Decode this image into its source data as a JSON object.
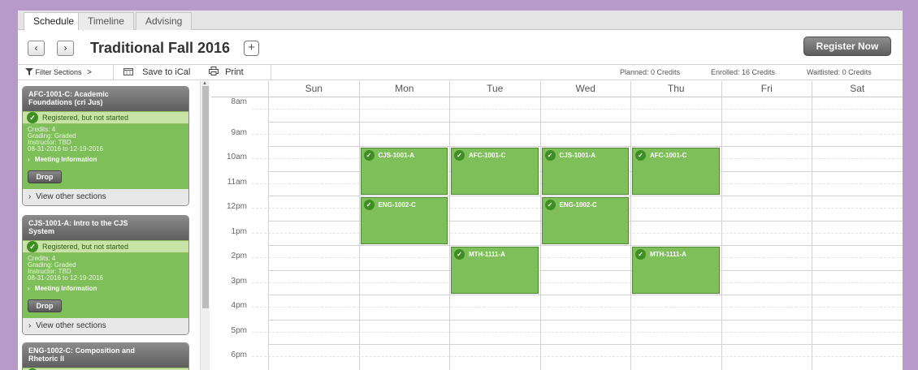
{
  "tabs": [
    {
      "label": "Schedule",
      "active": true
    },
    {
      "label": "Timeline",
      "active": false
    },
    {
      "label": "Advising",
      "active": false
    }
  ],
  "header": {
    "prev_icon": "chevron-left-icon",
    "next_icon": "chevron-right-icon",
    "term_title": "Traditional Fall 2016",
    "add_term_icon": "plus-icon",
    "register_label": "Register Now"
  },
  "toolbar": {
    "filter_label": "Filter Sections",
    "filter_chevron": ">",
    "ical_label": "Save to iCal",
    "print_label": "Print",
    "planned": "Planned:  0 Credits",
    "enrolled": "Enrolled:  16 Credits",
    "waitlisted": "Waitlisted:  0 Credits"
  },
  "courses": [
    {
      "title_line1": "AFC-1001-C: Academic",
      "title_line2": "Foundations (cri Jus)",
      "status": "Registered, but not started",
      "credits": "Credits: 4",
      "grading": "Grading: Graded",
      "instructor": "Instructor: TBD",
      "dates": "08-31-2016 to 12-19-2016",
      "meeting": "Meeting Information",
      "drop_label": "Drop",
      "other_sections": "View other sections"
    },
    {
      "title_line1": "CJS-1001-A: Intro to the CJS",
      "title_line2": "System",
      "status": "Registered, but not started",
      "credits": "Credits: 4",
      "grading": "Grading: Graded",
      "instructor": "Instructor: TBD",
      "dates": "08-31-2016 to 12-19-2016",
      "meeting": "Meeting Information",
      "drop_label": "Drop",
      "other_sections": "View other sections"
    },
    {
      "title_line1": "ENG-1002-C: Composition and",
      "title_line2": "Rhetoric II"
    }
  ],
  "days": [
    "Sun",
    "Mon",
    "Tue",
    "Wed",
    "Thu",
    "Fri",
    "Sat"
  ],
  "hours": [
    "8am",
    "9am",
    "10am",
    "11am",
    "12pm",
    "1pm",
    "2pm",
    "3pm",
    "4pm",
    "5pm",
    "6pm"
  ],
  "events": [
    {
      "label": "CJS-1001-A",
      "day": "Mon",
      "start": "10am",
      "end": "12pm"
    },
    {
      "label": "AFC-1001-C",
      "day": "Tue",
      "start": "10am",
      "end": "12pm"
    },
    {
      "label": "CJS-1001-A",
      "day": "Wed",
      "start": "10am",
      "end": "12pm"
    },
    {
      "label": "AFC-1001-C",
      "day": "Thu",
      "start": "10am",
      "end": "12pm"
    },
    {
      "label": "ENG-1002-C",
      "day": "Mon",
      "start": "12pm",
      "end": "2pm"
    },
    {
      "label": "ENG-1002-C",
      "day": "Wed",
      "start": "12pm",
      "end": "2pm"
    },
    {
      "label": "MTH-1111-A",
      "day": "Tue",
      "start": "2pm",
      "end": "4pm"
    },
    {
      "label": "MTH-1111-A",
      "day": "Thu",
      "start": "2pm",
      "end": "4pm"
    }
  ],
  "colors": {
    "event_green": "#7fbf5a",
    "status_green": "#c7e3a6",
    "check_green": "#3e8e23",
    "frame_purple": "#b79ac9"
  }
}
